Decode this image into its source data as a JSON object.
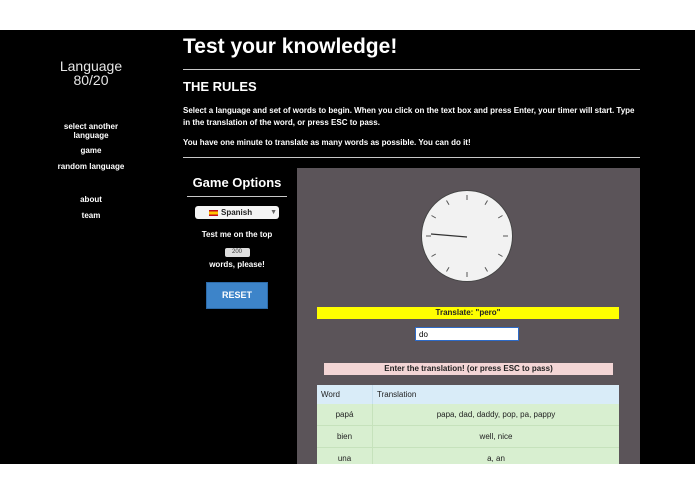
{
  "sidebar": {
    "brand_line1": "Language",
    "brand_line2": "80/20",
    "nav": {
      "select_line1": "select another",
      "select_line2": "language",
      "game": "game",
      "random": "random language",
      "about": "about",
      "team": "team"
    }
  },
  "main": {
    "title": "Test your knowledge!",
    "rules_heading": "THE RULES",
    "rules_p1": "Select a language and set of words to begin. When you click on the text box and press Enter, your timer will start. Type in the translation of the word, or press ESC to pass.",
    "rules_p2": "You have one minute to translate as many words as possible. You can do it!"
  },
  "options": {
    "heading": "Game Options",
    "language": "Spanish",
    "test_line1": "Test me on the top",
    "count": "200",
    "test_line2": "words, please!",
    "reset": "RESET"
  },
  "game": {
    "translate_prompt": "Translate: \"pero\"",
    "answer_value": "do",
    "hint": "Enter the translation! (or press ESC to pass)",
    "table": {
      "headers": [
        "Word",
        "Translation"
      ],
      "rows": [
        [
          "papá",
          "papa, dad, daddy, pop, pa, pappy"
        ],
        [
          "bien",
          "well, nice"
        ],
        [
          "una",
          "a, an"
        ]
      ]
    }
  },
  "colors": {
    "background": "#000000",
    "panel": "#5b5459",
    "reset_button": "#3d84c9",
    "translate_banner": "#ffff00",
    "hint_banner": "#f3d5d5",
    "table_header": "#d9ecf8",
    "table_row": "#d8efd0"
  },
  "icons": {
    "flag": "spain-flag-icon",
    "dropdown": "chevron-down-icon",
    "timer": "clock-icon"
  }
}
